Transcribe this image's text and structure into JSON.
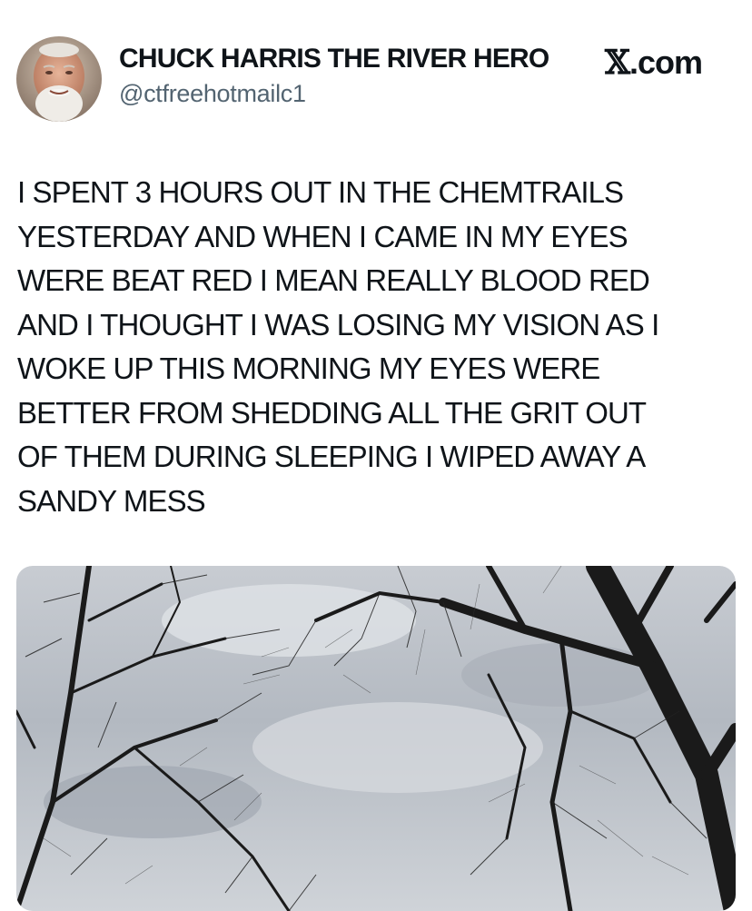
{
  "tweet": {
    "author": {
      "display_name": "CHUCK HARRIS THE RIVER HERO",
      "handle": "@ctfreehotmailc1",
      "avatar_icon": "profile-photo-icon"
    },
    "site_logo": {
      "mark": "𝕏",
      "suffix": ".com"
    },
    "text_lines": [
      "I SPENT 3 HOURS OUT IN THE CHEMTRAILS",
      "YESTERDAY AND WHEN I CAME IN MY EYES",
      "WERE BEAT RED I MEAN REALLY BLOOD RED",
      "AND I THOUGHT I WAS LOSING MY VISION AS I",
      "WOKE UP THIS MORNING MY EYES WERE",
      "BETTER FROM SHEDDING ALL THE GRIT OUT",
      "OF THEM DURING SLEEPING I WIPED AWAY A",
      "SANDY MESS"
    ],
    "media": {
      "type": "photo",
      "icon": "sky-through-bare-trees-photo"
    }
  },
  "colors": {
    "text": "#0f1419",
    "secondary_text": "#536471",
    "background": "#ffffff"
  }
}
